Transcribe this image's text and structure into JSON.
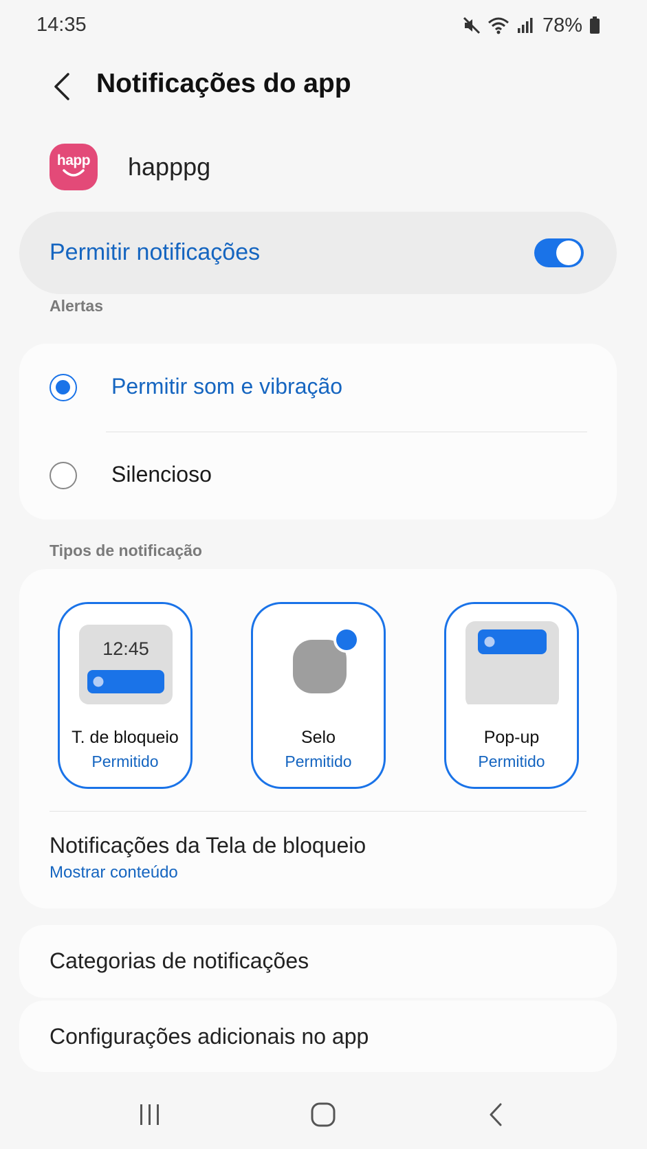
{
  "status_bar": {
    "time": "14:35",
    "battery": "78%",
    "icons": [
      "mute-icon",
      "wifi-icon",
      "signal-icon",
      "battery-icon"
    ]
  },
  "header": {
    "title": "Notificações do app",
    "back_icon": "chevron-left-icon"
  },
  "app": {
    "icon_text": "happ",
    "name": "happpg",
    "icon_color": "#e34a78"
  },
  "master_toggle": {
    "label": "Permitir notificações",
    "enabled": true
  },
  "alerts": {
    "section_label": "Alertas",
    "options": [
      {
        "label": "Permitir som e vibração",
        "selected": true
      },
      {
        "label": "Silencioso",
        "selected": false
      }
    ]
  },
  "notification_types": {
    "section_label": "Tipos de notificação",
    "tiles": [
      {
        "name": "T. de bloqueio",
        "status": "Permitido",
        "preview_time": "12:45"
      },
      {
        "name": "Selo",
        "status": "Permitido"
      },
      {
        "name": "Pop-up",
        "status": "Permitido"
      }
    ],
    "lock_screen": {
      "title": "Notificações da Tela de bloqueio",
      "value": "Mostrar conteúdo"
    }
  },
  "categories": {
    "label": "Categorias de notificações"
  },
  "additional": {
    "label": "Configurações adicionais no app"
  },
  "nav_bar": {
    "icons": [
      "recents-icon",
      "home-icon",
      "back-icon"
    ]
  },
  "colors": {
    "accent": "#1a73e8",
    "accent_text": "#1565c0",
    "background": "#f6f6f6"
  }
}
